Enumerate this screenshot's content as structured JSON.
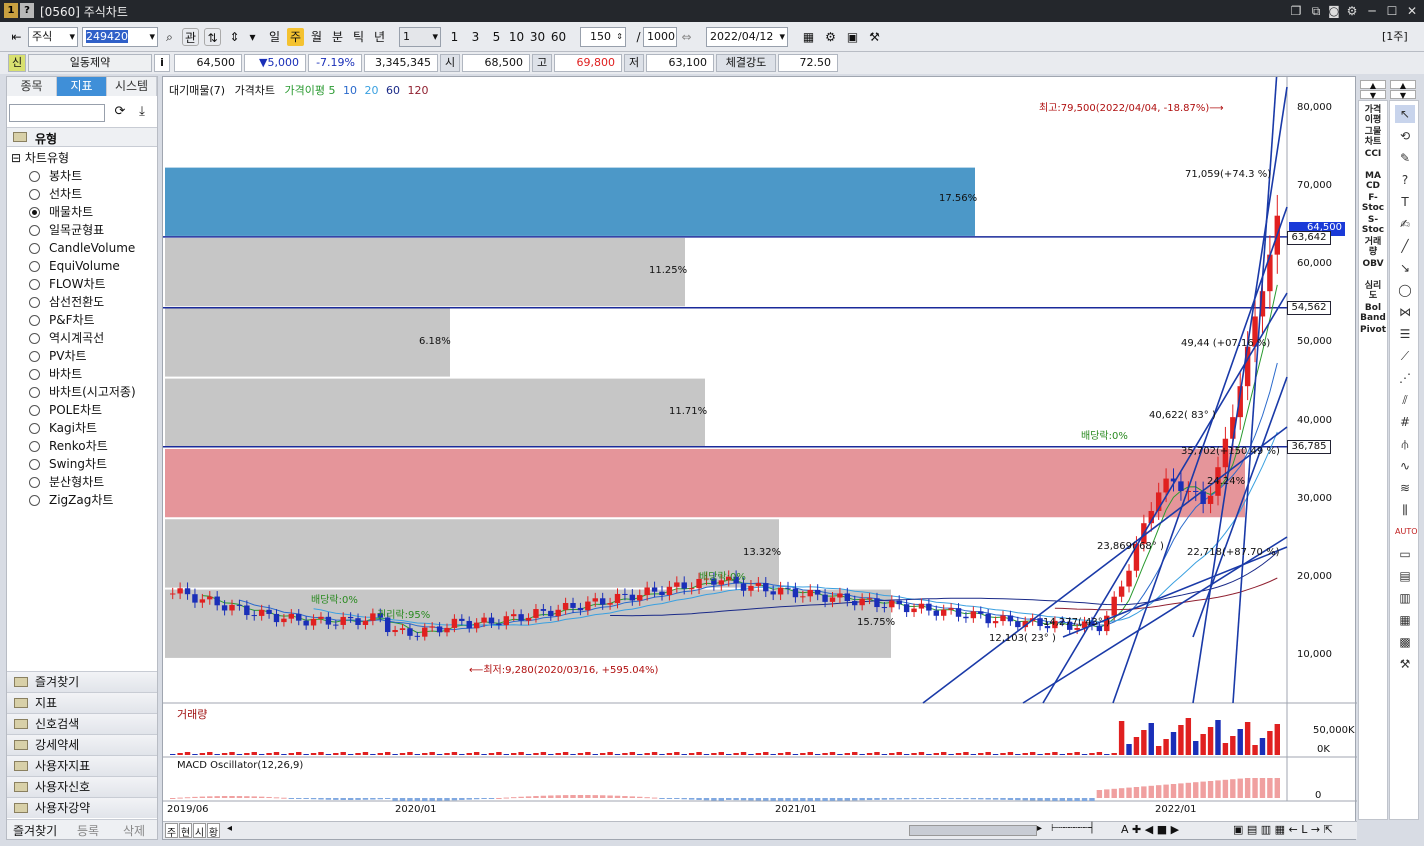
{
  "window": {
    "title": "[0560] 주식차트"
  },
  "toolbar": {
    "market": "주식",
    "code": "249420",
    "gwan": "관",
    "periods": [
      "일",
      "주",
      "월",
      "분",
      "틱",
      "년"
    ],
    "active_period": "주",
    "interval_select": "1",
    "minutes": [
      "1",
      "3",
      "5",
      "10",
      "30",
      "60"
    ],
    "count": "150",
    "count_sep": "/",
    "count_total": "1000",
    "date": "2022/04/12",
    "right_label": "[1주]"
  },
  "info": {
    "credit": "신",
    "name": "일동제약",
    "i": "i",
    "price": "64,500",
    "change": "▼5,000",
    "change_pct": "-7.19%",
    "volume": "3,345,345",
    "open_label": "시",
    "open": "68,500",
    "high_label": "고",
    "high": "69,800",
    "low_label": "저",
    "low": "63,100",
    "strength_label": "체결강도",
    "strength": "72.50"
  },
  "left": {
    "tabs": [
      "종목",
      "지표",
      "시스템"
    ],
    "active_tab": "지표",
    "section": "유형",
    "group": "차트유형",
    "types": [
      "봉차트",
      "선차트",
      "매물차트",
      "일목균형표",
      "CandleVolume",
      "EquiVolume",
      "FLOW차트",
      "삼선전환도",
      "P&F차트",
      "역시계곡선",
      "PV차트",
      "바차트",
      "바차트(시고저종)",
      "POLE차트",
      "Kagi차트",
      "Renko차트",
      "Swing차트",
      "분산형차트",
      "ZigZag차트"
    ],
    "selected_type": "매물차트",
    "categories": [
      "즐겨찾기",
      "지표",
      "신호검색",
      "강세약세",
      "사용자지표",
      "사용자신호",
      "사용자강약"
    ],
    "bottom_tabs": [
      "즐겨찾기",
      "등록",
      "삭제"
    ]
  },
  "chart": {
    "legend": [
      "대기매물(7)",
      "가격차트",
      "가격이평 5",
      "10",
      "20",
      "60",
      "120"
    ],
    "y_ticks": [
      "80,000",
      "70,000",
      "60,000",
      "50,000",
      "40,000",
      "30,000",
      "20,000",
      "10,000"
    ],
    "x_ticks": [
      "2019/06",
      "2020/01",
      "2021/01",
      "2022/01"
    ],
    "vp_labels": [
      "17.56%",
      "11.25%",
      "6.18%",
      "11.71%",
      "24.24%",
      "13.32%",
      "15.75%"
    ],
    "price_tags": [
      "64,500",
      "63,642",
      "54,562",
      "36,785"
    ],
    "annotations": {
      "high": "최고:79,500(2022/04/04, -18.87%)⟶",
      "low": "⟵최저:9,280(2020/03/16, +595.04%)",
      "div1": "배당락:0%",
      "div2": "배당락:0%",
      "div3": "배당락:0%",
      "ex1": "권리락:95%",
      "a1": "71,059(+74.3 %)",
      "a2": "49,44 (+07.16 %)",
      "a3": "40,622( 83° )",
      "a4": "35,702(+150.49 %)",
      "a5": "23,869( 68° )",
      "a6": "22,718(+87.70 %)",
      "a7": "12,103( 23° )",
      "a8": "14,277( 43° )"
    },
    "volume_label": "거래량",
    "volume_ticks": [
      "50,000K",
      "0K"
    ],
    "macd_label": "MACD Oscillator(12,26,9)",
    "macd_tick": "0",
    "bottom_btns": [
      "주",
      "현",
      "시",
      "황"
    ]
  },
  "rightbar1": [
    "가격\n이평",
    "그물\n차트",
    "CCI",
    "MA\nCD",
    "F-\nStoc",
    "S-\nStoc",
    "거래\n량",
    "OBV",
    "심리\n도",
    "Bol\nBand",
    "Pivot"
  ],
  "colors": {
    "vp_blue": "#4c98c8",
    "vp_pink": "#e5959a",
    "vp_grey": "#c6c6c6",
    "up": "#e02020",
    "down": "#1a2fb8"
  }
}
